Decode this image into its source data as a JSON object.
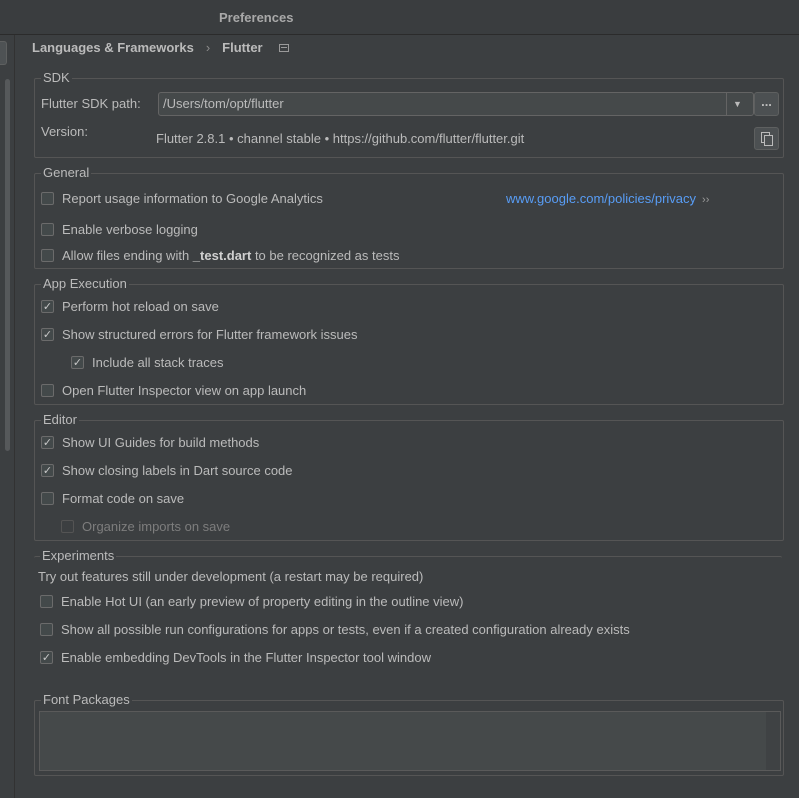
{
  "window": {
    "title": "Preferences"
  },
  "breadcrumb": {
    "parent": "Languages & Frameworks",
    "separator": "›",
    "current": "Flutter"
  },
  "sdk": {
    "legend": "SDK",
    "path_label": "Flutter SDK path:",
    "path_value": "/Users/tom/opt/flutter",
    "browse_label": "...",
    "version_label": "Version:",
    "version_value": "Flutter 2.8.1 • channel stable • https://github.com/flutter/flutter.git"
  },
  "general": {
    "legend": "General",
    "report_usage": {
      "label": "Report usage information to Google Analytics",
      "checked": false
    },
    "privacy_link": "www.google.com/policies/privacy",
    "privacy_link_arrow": "››",
    "verbose_logging": {
      "label": "Enable verbose logging",
      "checked": false
    },
    "test_files": {
      "prefix": "Allow files ending with ",
      "bold": "_test.dart",
      "suffix": " to be recognized as tests",
      "checked": false
    }
  },
  "app_execution": {
    "legend": "App Execution",
    "hot_reload": {
      "label": "Perform hot reload on save",
      "checked": true
    },
    "structured_errors": {
      "label": "Show structured errors for Flutter framework issues",
      "checked": true
    },
    "stack_traces": {
      "label": "Include all stack traces",
      "checked": true
    },
    "open_inspector": {
      "label": "Open Flutter Inspector view on app launch",
      "checked": false
    }
  },
  "editor": {
    "legend": "Editor",
    "ui_guides": {
      "label": "Show UI Guides for build methods",
      "checked": true
    },
    "closing_labels": {
      "label": "Show closing labels in Dart source code",
      "checked": true
    },
    "format_on_save": {
      "label": "Format code on save",
      "checked": false
    },
    "organize_imports": {
      "label": "Organize imports on save",
      "checked": false,
      "enabled": false
    }
  },
  "experiments": {
    "legend": "Experiments",
    "description": "Try out features still under development (a restart may be required)",
    "hot_ui": {
      "label": "Enable Hot UI (an early preview of property editing in the outline view)",
      "checked": false
    },
    "run_configs": {
      "label": "Show all possible run configurations for apps or tests, even if a created configuration already exists",
      "checked": false
    },
    "devtools": {
      "label": "Enable embedding DevTools in the Flutter Inspector tool window",
      "checked": true
    }
  },
  "font_packages": {
    "legend": "Font Packages"
  },
  "icons": {
    "checkmark": "✓"
  },
  "colors": {
    "link": "#589df6",
    "background": "#3c3f41",
    "text": "#bbbbbb"
  }
}
